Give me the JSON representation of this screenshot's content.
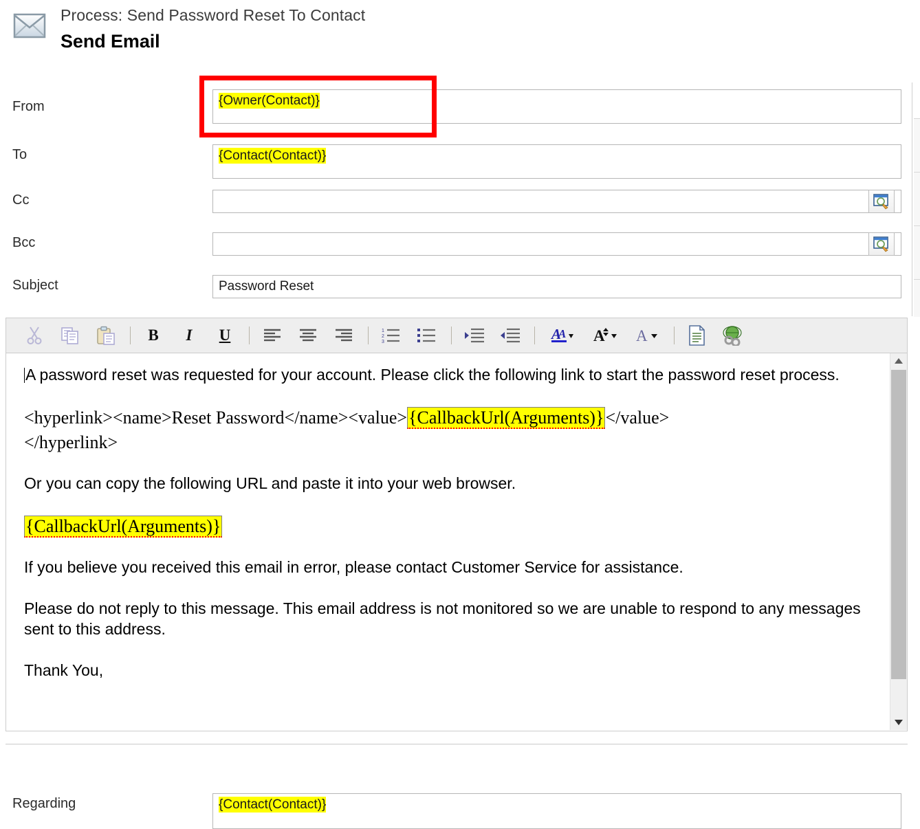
{
  "header": {
    "icon": "envelope-icon",
    "process_label": "Process: Send Password Reset To Contact",
    "form_title": "Send Email"
  },
  "fields": [
    {
      "label": "From",
      "value": "{Owner(Contact)}",
      "highlighted": true,
      "lookup": false
    },
    {
      "label": "To",
      "value": "{Contact(Contact)}",
      "highlighted": true,
      "lookup": false
    },
    {
      "label": "Cc",
      "value": "",
      "highlighted": false,
      "lookup": true
    },
    {
      "label": "Bcc",
      "value": "",
      "highlighted": false,
      "lookup": true
    },
    {
      "label": "Subject",
      "value": "Password Reset",
      "highlighted": false,
      "lookup": false
    },
    {
      "label": "Regarding",
      "value": "{Contact(Contact)}",
      "highlighted": true,
      "lookup": false
    }
  ],
  "toolbar": {
    "buttons": [
      {
        "name": "cut-icon",
        "title": "Cut"
      },
      {
        "name": "copy-icon",
        "title": "Copy"
      },
      {
        "name": "paste-icon",
        "title": "Paste"
      },
      {
        "name": "bold-icon",
        "title": "B"
      },
      {
        "name": "italic-icon",
        "title": "I"
      },
      {
        "name": "underline-icon",
        "title": "U"
      },
      {
        "name": "align-left-icon",
        "title": "Align Left"
      },
      {
        "name": "align-center-icon",
        "title": "Align Center"
      },
      {
        "name": "align-right-icon",
        "title": "Align Right"
      },
      {
        "name": "numbered-list-icon",
        "title": "Numbered List"
      },
      {
        "name": "bullet-list-icon",
        "title": "Bulleted List"
      },
      {
        "name": "indent-icon",
        "title": "Increase Indent"
      },
      {
        "name": "outdent-icon",
        "title": "Decrease Indent"
      },
      {
        "name": "font-color-icon",
        "title": "Font Color"
      },
      {
        "name": "font-size-icon",
        "title": "Font Size"
      },
      {
        "name": "font-name-icon",
        "title": "Font"
      },
      {
        "name": "source-view-icon",
        "title": "Source"
      },
      {
        "name": "hyperlink-icon",
        "title": "Insert Hyperlink"
      }
    ]
  },
  "body": {
    "p1": "A password reset was requested for your account. Please click the following link to start the password reset process.",
    "p2_pre": "<hyperlink><name>Reset Password</name><value>",
    "p2_token": "{CallbackUrl(Arguments)}",
    "p2_post": "</value>",
    "p2_line2": "</hyperlink>",
    "p3": "Or you can copy the following URL and paste it into your web browser.",
    "p4_token": "{CallbackUrl(Arguments)}",
    "p5": "If you believe you received this email in error, please contact Customer Service for assistance.",
    "p6": "Please do not reply to this message. This email address is not monitored so we are unable to respond to any messages sent to this address.",
    "p7": "Thank You,"
  },
  "colors": {
    "highlight": "#ffff00",
    "annotation": "#ff0000",
    "toolbar_bg": "#eeeeee",
    "field_border": "#b6b6b6"
  },
  "scrollbar": {
    "up_glyph": "▲",
    "down_glyph": "▼"
  }
}
